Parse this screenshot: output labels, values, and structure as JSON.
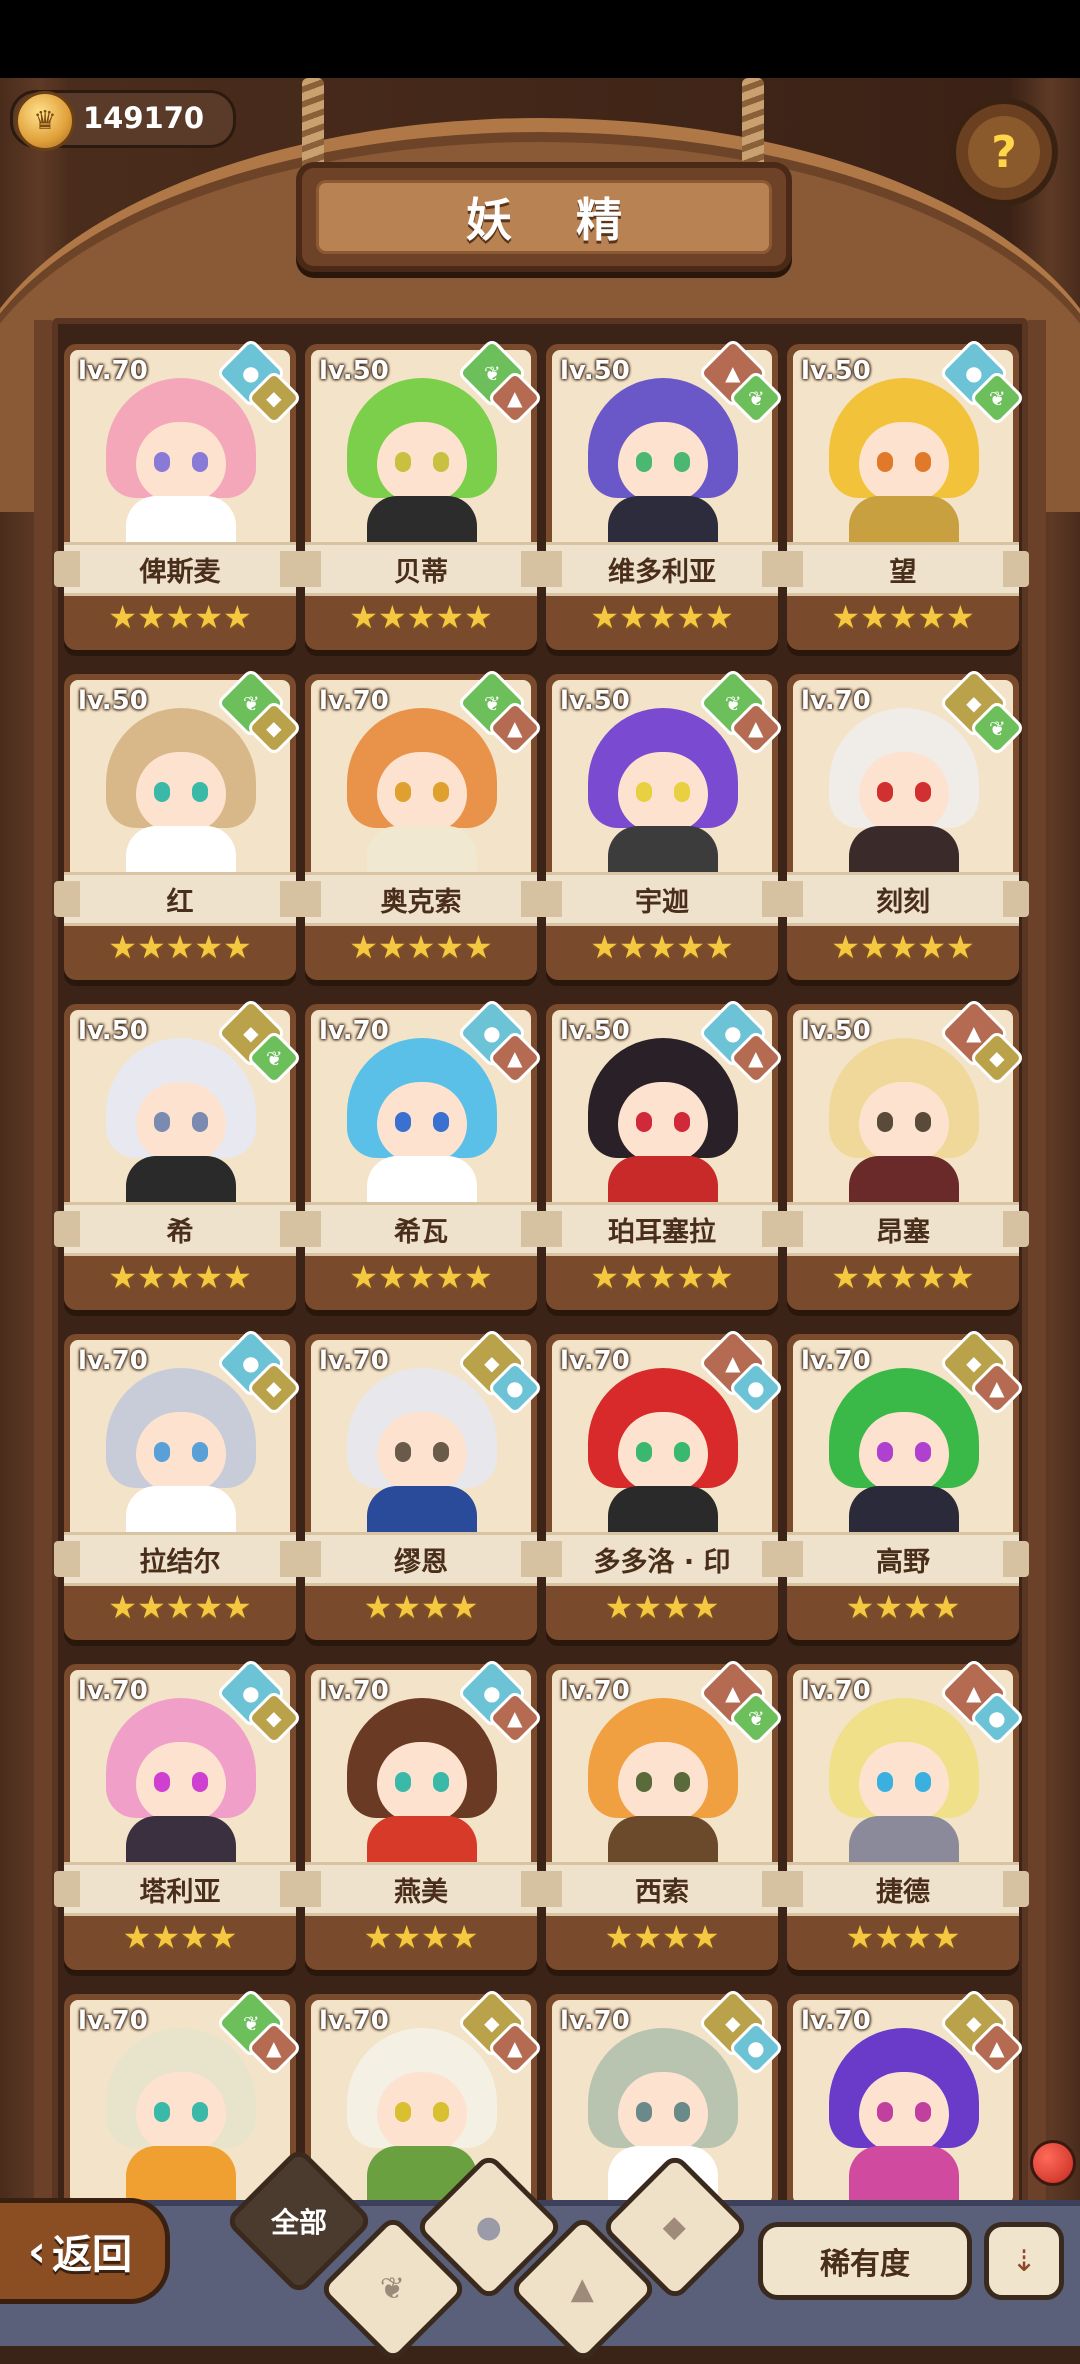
{
  "header": {
    "title": "妖 精",
    "coins": "149170",
    "help_icon": "question-sprout-icon"
  },
  "colors": {
    "water": "#6dc3d6",
    "nature": "#6cbf5a",
    "earth": "#b9a24a",
    "mountain": "#b46b52"
  },
  "fairies": [
    {
      "level": "lv.70",
      "name": "俾斯麦",
      "stars": "★★★★★",
      "elements": [
        "water",
        "earth"
      ],
      "hair": "#f4a7b8",
      "eyes": "#8a7ad8",
      "outfit": "#ffffff"
    },
    {
      "level": "lv.50",
      "name": "贝蒂",
      "stars": "★★★★★",
      "elements": [
        "nature",
        "mountain"
      ],
      "hair": "#7ccf4a",
      "eyes": "#c8c040",
      "outfit": "#2c2c2c"
    },
    {
      "level": "lv.50",
      "name": "维多利亚",
      "stars": "★★★★★",
      "elements": [
        "mountain",
        "nature"
      ],
      "hair": "#6a58c8",
      "eyes": "#4ab870",
      "outfit": "#2c2c3c"
    },
    {
      "level": "lv.50",
      "name": "望",
      "stars": "★★★★★",
      "elements": [
        "water",
        "nature"
      ],
      "hair": "#f2c23a",
      "eyes": "#e07a2a",
      "outfit": "#c8a040"
    },
    {
      "level": "lv.50",
      "name": "红",
      "stars": "★★★★★",
      "elements": [
        "nature",
        "earth"
      ],
      "hair": "#d8b888",
      "eyes": "#3ab8a8",
      "outfit": "#ffffff"
    },
    {
      "level": "lv.70",
      "name": "奥克索",
      "stars": "★★★★★",
      "elements": [
        "nature",
        "mountain"
      ],
      "hair": "#e8924a",
      "eyes": "#e0a030",
      "outfit": "#f0e8d0"
    },
    {
      "level": "lv.50",
      "name": "宇迦",
      "stars": "★★★★★",
      "elements": [
        "nature",
        "mountain"
      ],
      "hair": "#7a4ad0",
      "eyes": "#e8d040",
      "outfit": "#3c3c3c"
    },
    {
      "level": "lv.70",
      "name": "刻刻",
      "stars": "★★★★★",
      "elements": [
        "earth",
        "nature"
      ],
      "hair": "#f0ece8",
      "eyes": "#d03030",
      "outfit": "#3a2a2a"
    },
    {
      "level": "lv.50",
      "name": "希",
      "stars": "★★★★★",
      "elements": [
        "earth",
        "nature"
      ],
      "hair": "#e8e8f0",
      "eyes": "#7a8ab0",
      "outfit": "#2a2a2a"
    },
    {
      "level": "lv.70",
      "name": "希瓦",
      "stars": "★★★★★",
      "elements": [
        "water",
        "mountain"
      ],
      "hair": "#5ac0e8",
      "eyes": "#3a70d0",
      "outfit": "#ffffff"
    },
    {
      "level": "lv.50",
      "name": "珀耳塞拉",
      "stars": "★★★★★",
      "elements": [
        "water",
        "mountain"
      ],
      "hair": "#2a2028",
      "eyes": "#d02a3a",
      "outfit": "#c82a2a"
    },
    {
      "level": "lv.50",
      "name": "昂塞",
      "stars": "★★★★★",
      "elements": [
        "mountain",
        "earth"
      ],
      "hair": "#f0d89a",
      "eyes": "#5a4a3a",
      "outfit": "#6a2a2a"
    },
    {
      "level": "lv.70",
      "name": "拉结尔",
      "stars": "★★★★★",
      "elements": [
        "water",
        "earth"
      ],
      "hair": "#c8ccd8",
      "eyes": "#5aa0d8",
      "outfit": "#ffffff"
    },
    {
      "level": "lv.70",
      "name": "缪恩",
      "stars": "★★★★",
      "elements": [
        "earth",
        "water"
      ],
      "hair": "#e8e8ec",
      "eyes": "#6a5a4a",
      "outfit": "#2a4a9a"
    },
    {
      "level": "lv.70",
      "name": "多多洛 · 印",
      "stars": "★★★★",
      "elements": [
        "mountain",
        "water"
      ],
      "hair": "#d82a2a",
      "eyes": "#3ab870",
      "outfit": "#2a2a2a"
    },
    {
      "level": "lv.70",
      "name": "高野",
      "stars": "★★★★",
      "elements": [
        "earth",
        "mountain"
      ],
      "hair": "#3ab848",
      "eyes": "#b040d0",
      "outfit": "#2a2a3a"
    },
    {
      "level": "lv.70",
      "name": "塔利亚",
      "stars": "★★★★",
      "elements": [
        "water",
        "earth"
      ],
      "hair": "#f0a0c8",
      "eyes": "#d040d0",
      "outfit": "#3a3040"
    },
    {
      "level": "lv.70",
      "name": "燕美",
      "stars": "★★★★",
      "elements": [
        "water",
        "mountain"
      ],
      "hair": "#6a3a24",
      "eyes": "#3ab8a8",
      "outfit": "#d83a2a"
    },
    {
      "level": "lv.70",
      "name": "西索",
      "stars": "★★★★",
      "elements": [
        "mountain",
        "nature"
      ],
      "hair": "#f0a040",
      "eyes": "#5a6a3a",
      "outfit": "#6a4a2a"
    },
    {
      "level": "lv.70",
      "name": "捷德",
      "stars": "★★★★",
      "elements": [
        "mountain",
        "water"
      ],
      "hair": "#f0e08a",
      "eyes": "#3ab0e0",
      "outfit": "#8a8a9a"
    },
    {
      "level": "lv.70",
      "name": "",
      "stars": "",
      "elements": [
        "nature",
        "mountain"
      ],
      "hair": "#e8e4cc",
      "eyes": "#3ab8a8",
      "outfit": "#f0a030"
    },
    {
      "level": "lv.70",
      "name": "",
      "stars": "",
      "elements": [
        "earth",
        "mountain"
      ],
      "hair": "#f4f0e4",
      "eyes": "#d8c030",
      "outfit": "#6aa040"
    },
    {
      "level": "lv.70",
      "name": "",
      "stars": "",
      "elements": [
        "earth",
        "water"
      ],
      "hair": "#b8c4b0",
      "eyes": "#6a8a8a",
      "outfit": "#ffffff"
    },
    {
      "level": "lv.70",
      "name": "",
      "stars": "",
      "elements": [
        "earth",
        "mountain"
      ],
      "hair": "#6a3ac8",
      "eyes": "#c040a0",
      "outfit": "#d04aa0"
    }
  ],
  "bottom": {
    "back_label": "返回",
    "filter_all": "全部",
    "rarity_label": "稀有度",
    "sort_icon": "sort-descending-icon"
  }
}
